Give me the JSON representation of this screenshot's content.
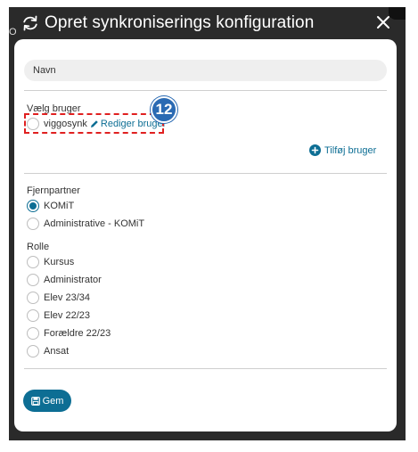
{
  "header": {
    "title": "Opret synkroniserings konfiguration"
  },
  "background": {
    "peek_text": "OM"
  },
  "form": {
    "name_placeholder": "Navn",
    "user_section_label": "Vælg bruger",
    "users": [
      {
        "label": "viggosynk",
        "selected": false
      }
    ],
    "edit_user_label": "Rediger bruger",
    "add_user_label": "Tilføj bruger",
    "callout_number": "12",
    "remote_partner_label": "Fjernpartner",
    "remote_partners": [
      {
        "label": "KOMiT",
        "selected": true
      },
      {
        "label": "Administrative - KOMiT",
        "selected": false
      }
    ],
    "role_label": "Rolle",
    "roles": [
      {
        "label": "Kursus",
        "selected": false
      },
      {
        "label": "Administrator",
        "selected": false
      },
      {
        "label": "Elev 23/34",
        "selected": false
      },
      {
        "label": "Elev 22/23",
        "selected": false
      },
      {
        "label": "Forældre 22/23",
        "selected": false
      },
      {
        "label": "Ansat",
        "selected": false
      }
    ],
    "save_label": "Gem"
  },
  "colors": {
    "accent": "#0d6e94",
    "callout": "#2a6ab3",
    "highlight": "#e02020",
    "header_bg": "#2a2a2a"
  }
}
